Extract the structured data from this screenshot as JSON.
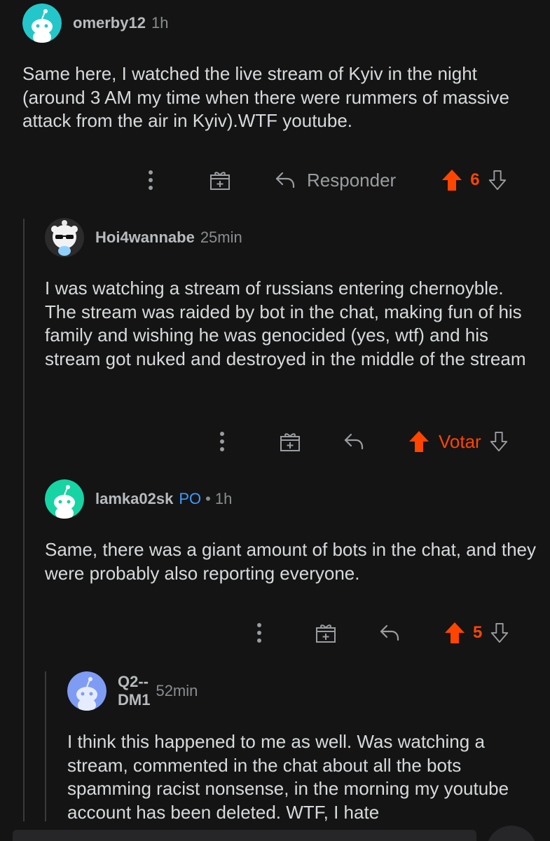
{
  "comments": [
    {
      "username": "omerby12",
      "time": "1h",
      "text": "Same here, I watched the live stream of Kyiv in the night (around 3 AM my time when there were rummers of massive attack from the air in Kyiv).WTF youtube.",
      "reply_label": "Responder",
      "score": "6",
      "avatar_color": "#24c7c9"
    },
    {
      "username": "Hoi4wannabe",
      "time": "25min",
      "text": "I was watching a stream of russians entering chernoyble. The stream was raided by bot in the chat, making fun of his family and wishing he was genocided (yes, wtf) and his stream got nuked and destroyed in the middle of the stream",
      "vote_label": "Votar",
      "avatar_color": "#2b2b2b"
    },
    {
      "username": "lamka02sk",
      "op_badge": "PO",
      "separator": "•",
      "time": "1h",
      "text": "Same, there was a giant amount of bots in the chat, and they were probably also reporting everyone.",
      "score": "5",
      "avatar_color": "#17d4a4"
    },
    {
      "username": "Q2--DM1",
      "time": "52min",
      "text": "I think this happened to me as well. Was watching a stream, commented in the chat about all the bots spamming racist nonsense, in the morning my youtube account has been deleted. WTF, I hate",
      "avatar_color": "#7f9cf5"
    }
  ],
  "colors": {
    "background": "#141414",
    "upvote_active": "#ff4500",
    "op_badge": "#3d9bff",
    "muted": "#8a8d90"
  },
  "icons": {
    "more": "more-vertical-icon",
    "award": "gift-award-icon",
    "reply": "reply-arrow-icon",
    "upvote": "upvote-arrow-icon",
    "downvote": "downvote-arrow-icon"
  }
}
